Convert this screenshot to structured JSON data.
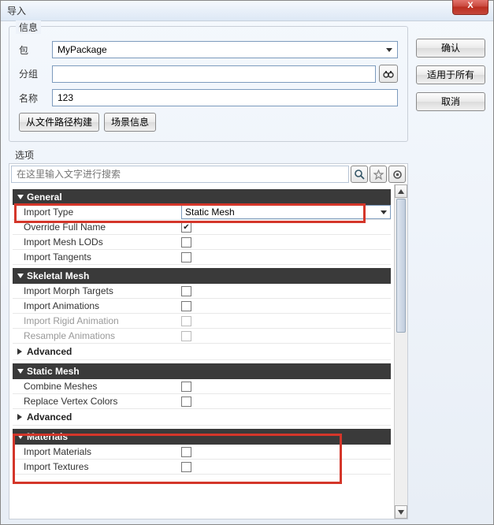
{
  "window": {
    "title": "导入"
  },
  "titlebar": {
    "close": "X"
  },
  "buttons": {
    "ok": "确认",
    "applyAll": "适用于所有",
    "cancel": "取消"
  },
  "info": {
    "legend": "信息",
    "packageLabel": "包",
    "packageValue": "MyPackage",
    "groupLabel": "分组",
    "groupValue": "",
    "nameLabel": "名称",
    "nameValue": "123",
    "buildFromPath": "从文件路径构建",
    "sceneInfo": "场景信息"
  },
  "options": {
    "legend": "选项",
    "searchPlaceholder": "在这里输入文字进行搜索",
    "sections": {
      "general": {
        "title": "General",
        "importTypeLabel": "Import Type",
        "importTypeValue": "Static Mesh",
        "overrideFullName": "Override Full Name",
        "importMeshLODs": "Import Mesh LODs",
        "importTangents": "Import Tangents"
      },
      "skeletal": {
        "title": "Skeletal Mesh",
        "importMorph": "Import Morph Targets",
        "importAnim": "Import Animations",
        "importRigid": "Import Rigid Animation",
        "resample": "Resample Animations",
        "advanced": "Advanced"
      },
      "static": {
        "title": "Static Mesh",
        "combine": "Combine Meshes",
        "replaceVC": "Replace Vertex Colors",
        "advanced": "Advanced"
      },
      "materials": {
        "title": "Materials",
        "importMat": "Import Materials",
        "importTex": "Import Textures"
      }
    }
  }
}
